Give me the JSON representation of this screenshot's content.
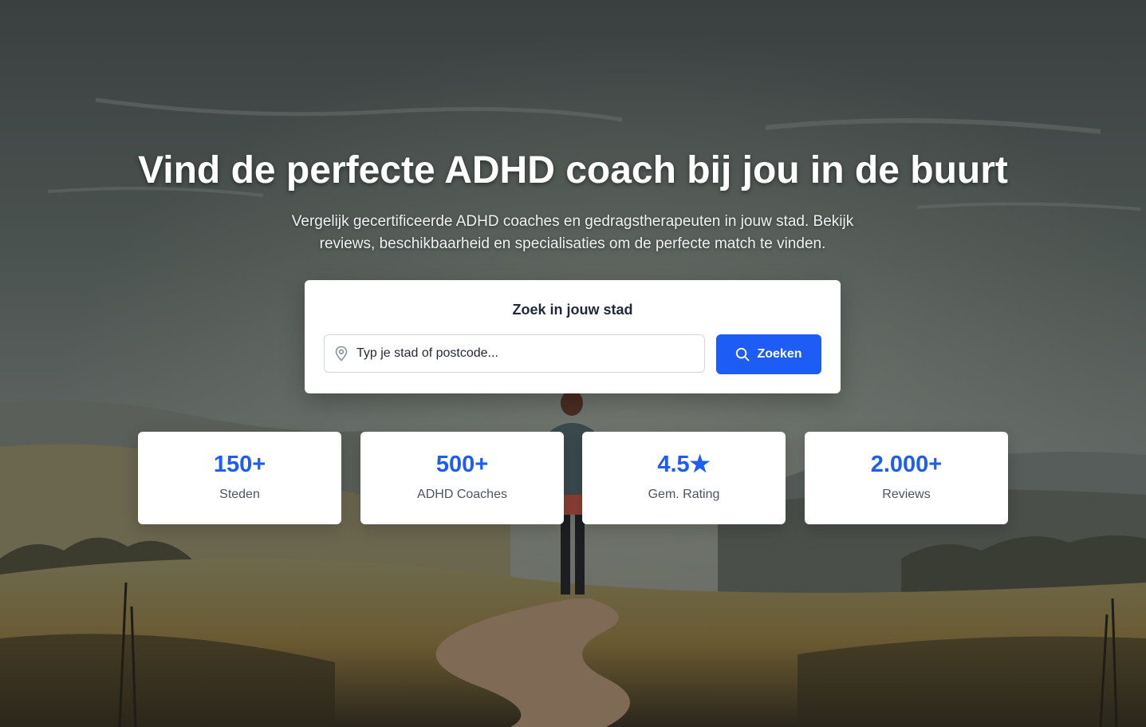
{
  "hero": {
    "headline": "Vind de perfecte ADHD coach bij jou in de buurt",
    "subtitle": "Vergelijk gecertificeerde ADHD coaches en gedragstherapeuten in jouw stad. Bekijk reviews, beschikbaarheid en specialisaties om de perfecte match te vinden."
  },
  "search": {
    "title": "Zoek in jouw stad",
    "placeholder": "Typ je stad of postcode...",
    "value": "",
    "button_label": "Zoeken",
    "location_icon": "map-pin-icon",
    "button_icon": "search-icon"
  },
  "stats": [
    {
      "value": "150+",
      "label": "Steden"
    },
    {
      "value": "500+",
      "label": "ADHD Coaches"
    },
    {
      "value": "4.5★",
      "label": "Gem. Rating"
    },
    {
      "value": "2.000+",
      "label": "Reviews"
    }
  ],
  "colors": {
    "accent": "#1d5cf5",
    "card_background": "#ffffff",
    "headline_text": "#ffffff"
  }
}
